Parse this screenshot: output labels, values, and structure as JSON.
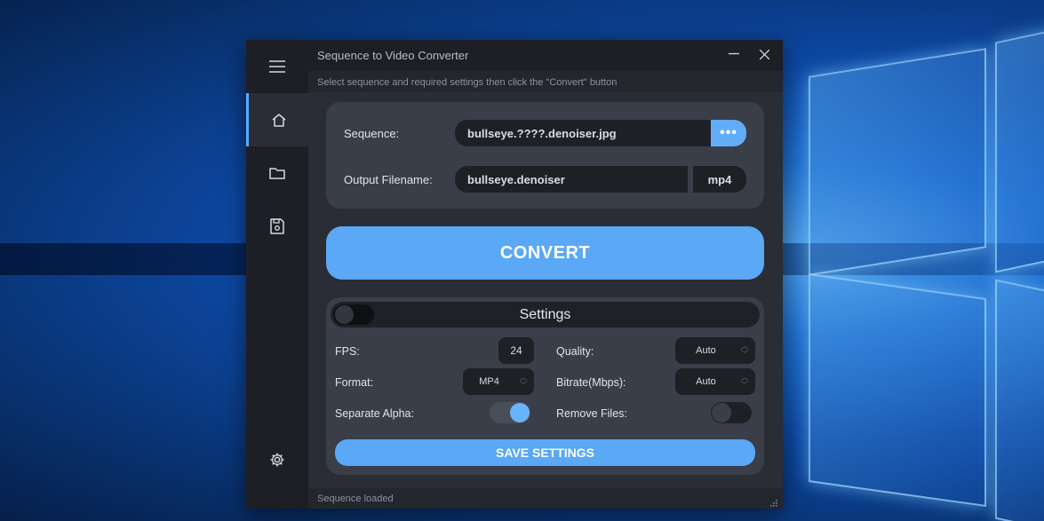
{
  "app": {
    "title": "Sequence to Video Converter",
    "instructions": "Select sequence and required settings then click the \"Convert\" button"
  },
  "window_controls": {
    "minimize": "—",
    "close": "✕"
  },
  "sidebar": {
    "items": [
      {
        "name": "menu",
        "icon": "hamburger-icon"
      },
      {
        "name": "home",
        "icon": "home-icon",
        "active": true
      },
      {
        "name": "open",
        "icon": "folder-icon"
      },
      {
        "name": "save",
        "icon": "save-icon"
      },
      {
        "name": "settings",
        "icon": "gear-icon"
      }
    ]
  },
  "input": {
    "sequence_label": "Sequence:",
    "sequence_value": "bullseye.????.denoiser.jpg",
    "browse_label": "•••",
    "output_label": "Output Filename:",
    "output_value": "bullseye.denoiser",
    "output_ext": "mp4"
  },
  "convert": {
    "label": "CONVERT"
  },
  "settings": {
    "title": "Settings",
    "panel_toggle_on": false,
    "fps_label": "FPS:",
    "fps_value": "24",
    "quality_label": "Quality:",
    "quality_value": "Auto",
    "format_label": "Format:",
    "format_value": "MP4",
    "bitrate_label": "Bitrate(Mbps):",
    "bitrate_value": "Auto",
    "separate_alpha_label": "Separate Alpha:",
    "separate_alpha_on": true,
    "remove_files_label": "Remove Files:",
    "remove_files_on": false,
    "save_label": "SAVE SETTINGS"
  },
  "status": {
    "text": "Sequence loaded"
  },
  "colors": {
    "accent": "#5aa8f6",
    "sidebar_bg": "#1d1f24",
    "window_bg": "#2a2d35",
    "card_bg": "#3a3e48"
  }
}
